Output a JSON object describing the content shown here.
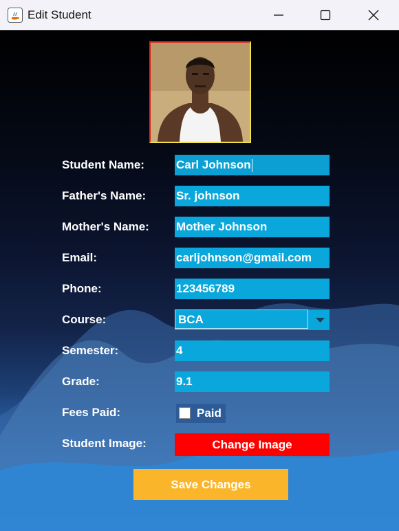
{
  "window": {
    "title": "Edit Student",
    "controls": [
      "minimize-icon",
      "maximize-icon",
      "close-icon"
    ]
  },
  "form": {
    "labels": {
      "student_name": "Student Name:",
      "father_name": "Father's Name:",
      "mother_name": "Mother's Name:",
      "email": "Email:",
      "phone": "Phone:",
      "course": "Course:",
      "semester": "Semester:",
      "grade": "Grade:",
      "fees_paid": "Fees Paid:",
      "student_image": "Student Image:"
    },
    "values": {
      "student_name": "Carl Johnson",
      "father_name": "Sr. johnson",
      "mother_name": "Mother Johnson",
      "email": "carljohnson@gmail.com",
      "phone": "123456789",
      "course": "BCA",
      "semester": "4",
      "grade": "9.1"
    },
    "fees_paid": {
      "label": "Paid",
      "checked": false
    },
    "change_image_label": "Change Image",
    "save_label": "Save Changes"
  },
  "colors": {
    "field_bg": "#0aa7dd",
    "change_image_bg": "#ff0000",
    "save_bg": "#fbb52b",
    "photo_border": "#e21b1b"
  }
}
